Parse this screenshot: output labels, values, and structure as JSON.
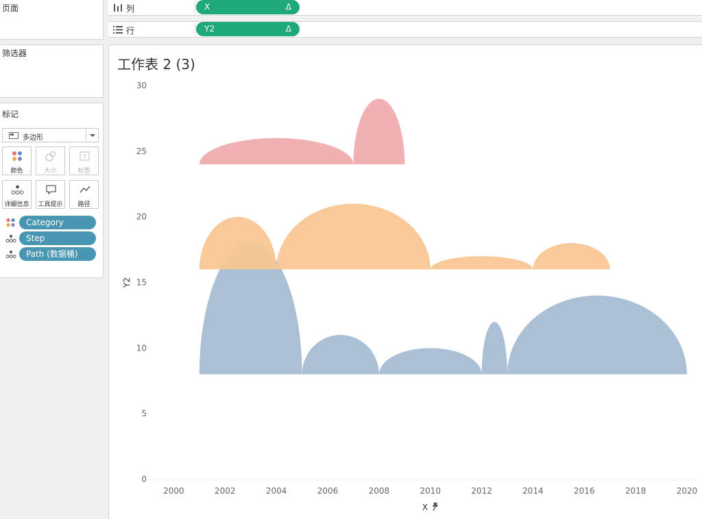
{
  "panels": {
    "pages": "页面",
    "filters": "筛选器",
    "marks": "标记"
  },
  "marks": {
    "type_label": "多边形",
    "buttons": [
      {
        "label": "颜色",
        "icon": "color-dots-icon",
        "enabled": true
      },
      {
        "label": "大小",
        "icon": "size-circles-icon",
        "enabled": false
      },
      {
        "label": "标签",
        "icon": "label-t-icon",
        "enabled": false
      },
      {
        "label": "详细信息",
        "icon": "detail-dots-icon",
        "enabled": true
      },
      {
        "label": "工具提示",
        "icon": "tooltip-bubble-icon",
        "enabled": true
      },
      {
        "label": "路径",
        "icon": "path-line-icon",
        "enabled": true
      }
    ],
    "pills": [
      {
        "label": "Category",
        "icon": "color-dots-icon"
      },
      {
        "label": "Step",
        "icon": "detail-dots-icon"
      },
      {
        "label": "Path (数据桶)",
        "icon": "detail-dots-icon"
      }
    ]
  },
  "shelves": {
    "columns": {
      "label": "列",
      "pill": "X",
      "delta": "Δ"
    },
    "rows": {
      "label": "行",
      "pill": "Y2",
      "delta": "Δ"
    }
  },
  "sheet_title": "工作表 2 (3)",
  "colors": {
    "blue": "#a8bdd3",
    "orange": "#f8c795",
    "pink": "#f0adb0",
    "pill_teal": "#4996b2",
    "pill_green": "#1fa878"
  },
  "chart_data": {
    "type": "area",
    "xlabel": "X",
    "ylabel": "Y2",
    "xlim": [
      1999,
      2020.4
    ],
    "ylim": [
      0,
      30
    ],
    "x_ticks": [
      2000,
      2002,
      2004,
      2006,
      2008,
      2010,
      2012,
      2014,
      2016,
      2018,
      2020
    ],
    "y_ticks": [
      0,
      5,
      10,
      15,
      20,
      25,
      30
    ],
    "series": [
      {
        "color": "#a8bdd3",
        "baseline": 8,
        "arcs": [
          {
            "x_start": 2001,
            "x_end": 2005,
            "peak": 18
          },
          {
            "x_start": 2005,
            "x_end": 2008,
            "peak": 11
          },
          {
            "x_start": 2008,
            "x_end": 2012,
            "peak": 10
          },
          {
            "x_start": 2012,
            "x_end": 2013,
            "peak": 12
          },
          {
            "x_start": 2013,
            "x_end": 2020,
            "peak": 14
          }
        ]
      },
      {
        "color": "#f8c795",
        "baseline": 16,
        "arcs": [
          {
            "x_start": 2001,
            "x_end": 2004,
            "peak": 20
          },
          {
            "x_start": 2004,
            "x_end": 2010,
            "peak": 21
          },
          {
            "x_start": 2010,
            "x_end": 2014,
            "peak": 17
          },
          {
            "x_start": 2014,
            "x_end": 2017,
            "peak": 18
          }
        ]
      },
      {
        "color": "#f0adb0",
        "baseline": 24,
        "arcs": [
          {
            "x_start": 2001,
            "x_end": 2007,
            "peak": 26
          },
          {
            "x_start": 2007,
            "x_end": 2009,
            "peak": 29
          }
        ]
      }
    ]
  }
}
